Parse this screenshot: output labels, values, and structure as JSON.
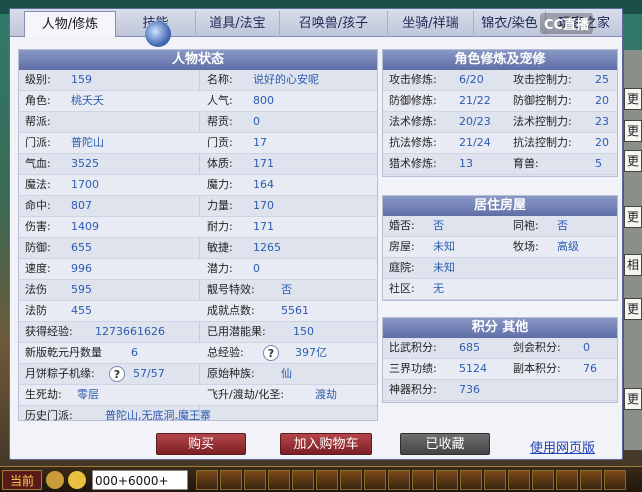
{
  "tabs": [
    "人物/修炼",
    "技能",
    "道具/法宝",
    "召唤兽/孩子",
    "坐骑/祥瑞",
    "锦衣/染色",
    "玩家之家"
  ],
  "watermark": "CC直播",
  "right_chips": [
    "更",
    "更",
    "更",
    "更",
    "相",
    "更",
    "更"
  ],
  "status_panel": {
    "title": "人物状态",
    "rows": [
      {
        "l1": "级别:",
        "v1": "159",
        "l2": "名称:",
        "v2": "说好的心安呢"
      },
      {
        "l1": "角色:",
        "v1": "桃夭夭",
        "l2": "人气:",
        "v2": "800"
      },
      {
        "l1": "帮派:",
        "v1": "",
        "l2": "帮贡:",
        "v2": "0"
      },
      {
        "l1": "门派:",
        "v1": "普陀山",
        "l2": "门贡:",
        "v2": "17"
      },
      {
        "l1": "气血:",
        "v1": "3525",
        "l2": "体质:",
        "v2": "171"
      },
      {
        "l1": "魔法:",
        "v1": "1700",
        "l2": "魔力:",
        "v2": "164"
      },
      {
        "l1": "命中:",
        "v1": "807",
        "l2": "力量:",
        "v2": "170"
      },
      {
        "l1": "伤害:",
        "v1": "1409",
        "l2": "耐力:",
        "v2": "171"
      },
      {
        "l1": "防御:",
        "v1": "655",
        "l2": "敏捷:",
        "v2": "1265"
      },
      {
        "l1": "速度:",
        "v1": "996",
        "l2": "潜力:",
        "v2": "0"
      },
      {
        "l1": "法伤",
        "v1": "595",
        "l2": "靓号特效:",
        "v2": "否"
      },
      {
        "l1": "法防",
        "v1": "455",
        "l2": "成就点数:",
        "v2": "5561"
      },
      {
        "l1": "获得经验:",
        "v1": "1273661626",
        "l2": "已用潜能果:",
        "v2": "150"
      },
      {
        "l1": "新版乾元丹数量",
        "v1": "6",
        "l2": "总经验:",
        "v2": "397亿"
      },
      {
        "l1": "月饼粽子机缘:",
        "v1": "57/57",
        "l2": "原始种族:",
        "v2": "仙"
      },
      {
        "l1": "生死劫:",
        "v1": "零层",
        "l2": "飞升/渡劫/化圣:",
        "v2": "渡劫"
      }
    ],
    "history_label": "历史门派:",
    "history_value": "普陀山,无底洞,魔王寨"
  },
  "cultivation_panel": {
    "title": "角色修炼及宠修",
    "rows": [
      {
        "l1": "攻击修炼:",
        "v1": "6/20",
        "l2": "攻击控制力:",
        "v2": "25"
      },
      {
        "l1": "防御修炼:",
        "v1": "21/22",
        "l2": "防御控制力:",
        "v2": "20"
      },
      {
        "l1": "法术修炼:",
        "v1": "20/23",
        "l2": "法术控制力:",
        "v2": "23"
      },
      {
        "l1": "抗法修炼:",
        "v1": "21/24",
        "l2": "抗法控制力:",
        "v2": "20"
      },
      {
        "l1": "猎术修炼:",
        "v1": "13",
        "l2": "育兽:",
        "v2": "5"
      }
    ]
  },
  "house_panel": {
    "title": "居住房屋",
    "rows": [
      {
        "l1": "婚否:",
        "v1": "否",
        "l2": "同袍:",
        "v2": "否"
      },
      {
        "l1": "房屋:",
        "v1": "未知",
        "l2": "牧场:",
        "v2": "高级"
      },
      {
        "l1": "庭院:",
        "v1": "未知",
        "l2": "",
        "v2": ""
      },
      {
        "l1": "社区:",
        "v1": "无",
        "l2": "",
        "v2": ""
      }
    ]
  },
  "score_panel": {
    "title": "积分 其他",
    "rows": [
      {
        "l1": "比武积分:",
        "v1": "685",
        "l2": "剑会积分:",
        "v2": "0"
      },
      {
        "l1": "三界功绩:",
        "v1": "5124",
        "l2": "副本积分:",
        "v2": "76"
      },
      {
        "l1": "神器积分:",
        "v1": "736",
        "l2": "",
        "v2": ""
      }
    ]
  },
  "help_icon_glyph": "?",
  "buttons": {
    "buy": "购买",
    "add_cart": "加入购物车",
    "collected": "已收藏",
    "web_version": "使用网页版"
  },
  "chat": {
    "channel": "当前",
    "input_value": "000+6000+"
  }
}
